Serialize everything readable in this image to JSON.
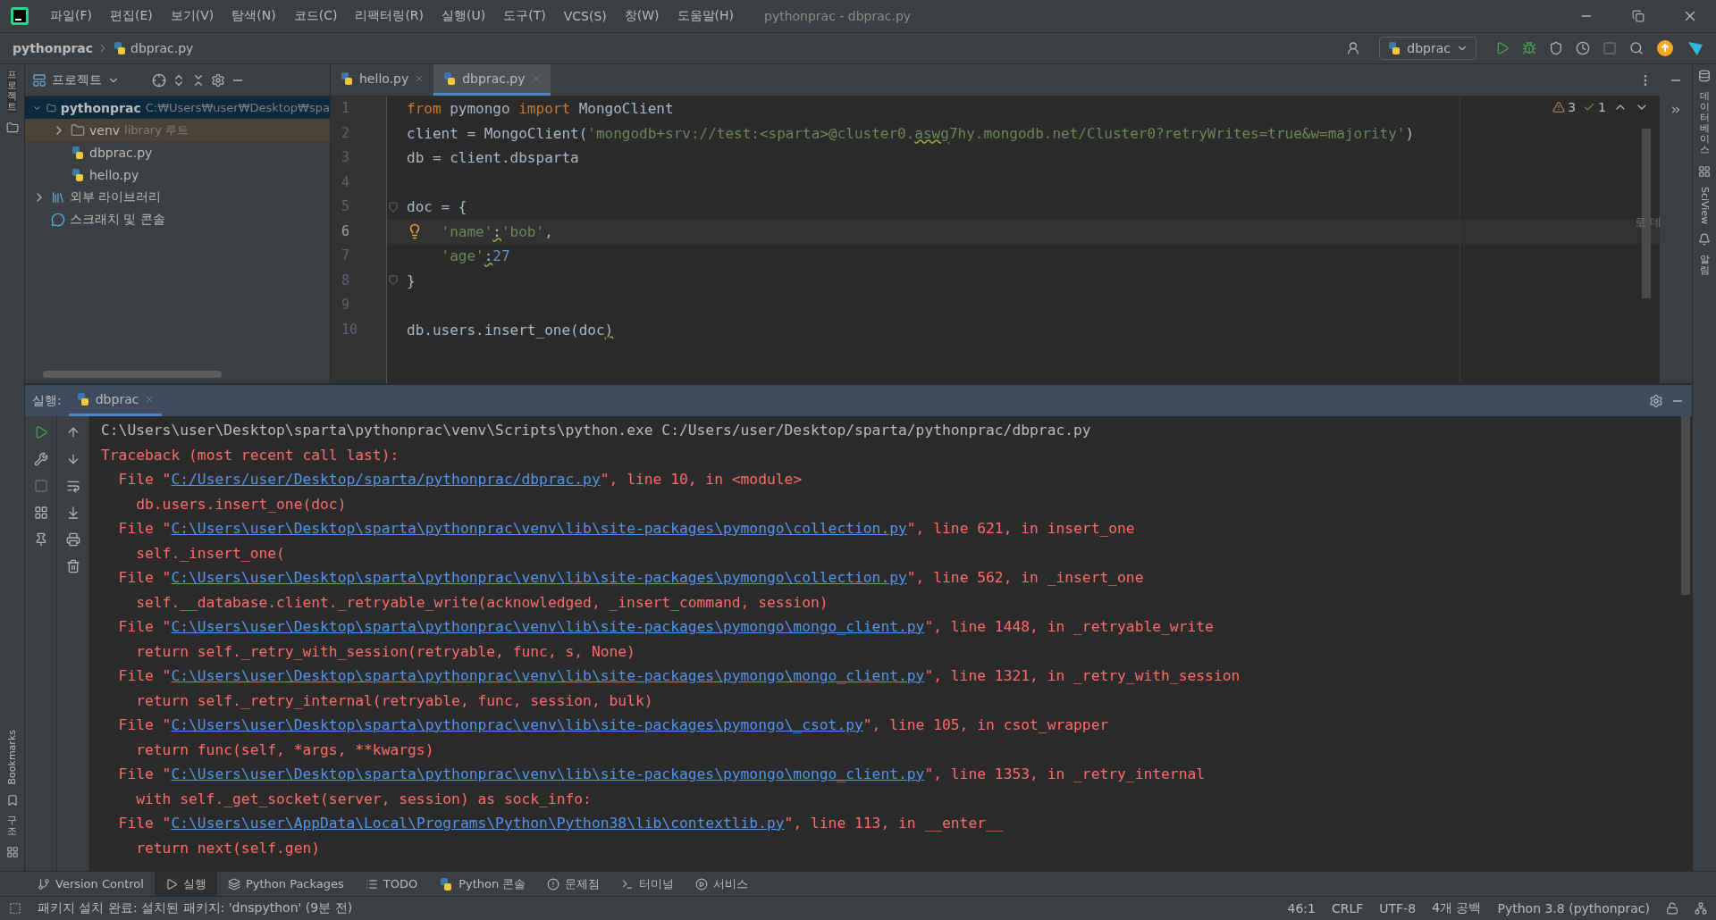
{
  "window": {
    "title": "pythonprac - dbprac.py"
  },
  "menu": [
    "파일(F)",
    "편집(E)",
    "보기(V)",
    "탐색(N)",
    "코드(C)",
    "리팩터링(R)",
    "실행(U)",
    "도구(T)",
    "VCS(S)",
    "창(W)",
    "도움말(H)"
  ],
  "breadcrumb": [
    "pythonprac",
    "dbprac.py"
  ],
  "run_config": "dbprac",
  "left_stripe": [
    "프로젝트",
    "Bookmarks",
    "구조"
  ],
  "project_panel": {
    "title": "프로젝트",
    "tree": [
      {
        "label": "pythonprac",
        "detail": "C:₩Users₩user₩Desktop₩spa",
        "kind": "folder",
        "expanded": true,
        "selected": true,
        "children": [
          {
            "label": "venv",
            "detail": "library 루트",
            "kind": "library-folder",
            "expanded": false,
            "selected": false
          },
          {
            "label": "dbprac.py",
            "kind": "python",
            "selected": false
          },
          {
            "label": "hello.py",
            "kind": "python",
            "selected": false
          }
        ]
      },
      {
        "label": "외부 라이브러리",
        "kind": "libraries",
        "expanded": false,
        "selected": false
      },
      {
        "label": "스크래치 및 콘솔",
        "kind": "scratches",
        "selected": false
      }
    ]
  },
  "editor": {
    "tabs": [
      {
        "label": "hello.py",
        "selected": false
      },
      {
        "label": "dbprac.py",
        "selected": true
      }
    ],
    "inspections": {
      "warnings": "3",
      "ok": "1"
    },
    "side_hint": "로 데",
    "lines": [
      {
        "number": "1",
        "kind": "top",
        "current": false,
        "tokens": [
          {
            "kind": "keyword",
            "text": "from"
          },
          {
            "kind": "text",
            "text": " pymongo "
          },
          {
            "kind": "keyword",
            "text": "import"
          },
          {
            "kind": "text",
            "text": " MongoClient"
          }
        ]
      },
      {
        "number": "2",
        "kind": "top",
        "current": false,
        "tokens": [
          {
            "kind": "text",
            "text": "client = MongoClient("
          },
          {
            "kind": "string",
            "text": "'mongodb+srv://test:<sparta>@cluster0."
          },
          {
            "kind": "string_warn",
            "text": "aswg"
          },
          {
            "kind": "string",
            "text": "7hy.mongodb.net/Cluster0?retryWrites=true&w=majority'"
          },
          {
            "kind": "text",
            "text": ")"
          }
        ]
      },
      {
        "number": "3",
        "kind": "top",
        "current": false,
        "tokens": [
          {
            "kind": "text",
            "text": "db = client.dbsparta"
          }
        ]
      },
      {
        "number": "4",
        "kind": "top",
        "current": false
      },
      {
        "number": "5",
        "kind": "top",
        "current": false,
        "fold": true,
        "tokens": [
          {
            "kind": "text",
            "text": "doc = {"
          }
        ]
      },
      {
        "number": "6",
        "kind": "indented",
        "current": true,
        "bulb": true,
        "tokens": [
          {
            "kind": "string",
            "text": "'name'"
          },
          {
            "kind": "warn",
            "text": ":"
          },
          {
            "kind": "string",
            "text": "'bob'"
          },
          {
            "kind": "text",
            "text": ","
          }
        ]
      },
      {
        "number": "7",
        "kind": "indented",
        "current": false,
        "tokens": [
          {
            "kind": "string",
            "text": "'age'"
          },
          {
            "kind": "warn",
            "text": ":"
          },
          {
            "kind": "number",
            "text": "27"
          }
        ]
      },
      {
        "number": "8",
        "kind": "top",
        "current": false,
        "fold": true,
        "tokens": [
          {
            "kind": "text",
            "text": "}"
          }
        ]
      },
      {
        "number": "9",
        "kind": "top",
        "current": false
      },
      {
        "number": "10",
        "kind": "top",
        "current": false,
        "tokens": [
          {
            "kind": "text",
            "text": "db.users.insert_one(doc"
          },
          {
            "kind": "warn",
            "text": ")"
          }
        ]
      }
    ]
  },
  "right_stripe": [
    "데이터베이스",
    "SciView",
    "알림"
  ],
  "run_panel": {
    "label": "실행:",
    "tabs": [
      {
        "label": "dbprac",
        "selected": true
      }
    ],
    "console": [
      {
        "kind": "command",
        "text": "C:\\Users\\user\\Desktop\\sparta\\pythonprac\\venv\\Scripts\\python.exe C:/Users/user/Desktop/sparta/pythonprac/dbprac.py"
      },
      {
        "kind": "error",
        "text": "Traceback (most recent call last):"
      },
      {
        "kind": "file",
        "prefix": "File \"",
        "link": "C:/Users/user/Desktop/sparta/pythonprac/dbprac.py",
        "suffix": "\", line 10, in <module>"
      },
      {
        "kind": "code",
        "text": "db.users.insert_one(doc)"
      },
      {
        "kind": "file",
        "prefix": "File \"",
        "link": "C:\\Users\\user\\Desktop\\sparta\\pythonprac\\venv\\lib\\site-packages\\pymongo\\collection.py",
        "suffix": "\", line 621, in insert_one"
      },
      {
        "kind": "code",
        "text": "self._insert_one("
      },
      {
        "kind": "file",
        "prefix": "File \"",
        "link": "C:\\Users\\user\\Desktop\\sparta\\pythonprac\\venv\\lib\\site-packages\\pymongo\\collection.py",
        "suffix": "\", line 562, in _insert_one"
      },
      {
        "kind": "code",
        "text": "self.__database.client._retryable_write(acknowledged, _insert_command, session)"
      },
      {
        "kind": "file",
        "prefix": "File \"",
        "link": "C:\\Users\\user\\Desktop\\sparta\\pythonprac\\venv\\lib\\site-packages\\pymongo\\mongo_client.py",
        "suffix": "\", line 1448, in _retryable_write"
      },
      {
        "kind": "code",
        "text": "return self._retry_with_session(retryable, func, s, None)"
      },
      {
        "kind": "file",
        "prefix": "File \"",
        "link": "C:\\Users\\user\\Desktop\\sparta\\pythonprac\\venv\\lib\\site-packages\\pymongo\\mongo_client.py",
        "suffix": "\", line 1321, in _retry_with_session"
      },
      {
        "kind": "code",
        "text": "return self._retry_internal(retryable, func, session, bulk)"
      },
      {
        "kind": "file",
        "prefix": "File \"",
        "link": "C:\\Users\\user\\Desktop\\sparta\\pythonprac\\venv\\lib\\site-packages\\pymongo\\_csot.py",
        "suffix": "\", line 105, in csot_wrapper"
      },
      {
        "kind": "code",
        "text": "return func(self, *args, **kwargs)"
      },
      {
        "kind": "file",
        "prefix": "File \"",
        "link": "C:\\Users\\user\\Desktop\\sparta\\pythonprac\\venv\\lib\\site-packages\\pymongo\\mongo_client.py",
        "suffix": "\", line 1353, in _retry_internal"
      },
      {
        "kind": "code",
        "text": "with self._get_socket(server, session) as sock_info:"
      },
      {
        "kind": "file",
        "prefix": "File \"",
        "link": "C:\\Users\\user\\AppData\\Local\\Programs\\Python\\Python38\\lib\\contextlib.py",
        "suffix": "\", line 113, in __enter__"
      },
      {
        "kind": "code",
        "text": "return next(self.gen)"
      }
    ]
  },
  "tool_bar": [
    {
      "label": "Version Control",
      "kind": "vcs",
      "selected": false
    },
    {
      "label": "실행",
      "kind": "run",
      "selected": true
    },
    {
      "label": "Python Packages",
      "kind": "packages",
      "selected": false
    },
    {
      "label": "TODO",
      "kind": "todo",
      "selected": false
    },
    {
      "label": "Python 콘솔",
      "kind": "python",
      "selected": false
    },
    {
      "label": "문제점",
      "kind": "problems",
      "selected": false
    },
    {
      "label": "터미널",
      "kind": "terminal",
      "selected": false
    },
    {
      "label": "서비스",
      "kind": "services",
      "selected": false
    }
  ],
  "status_bar": {
    "message": "패키지 설치 완료: 설치된 패키지: 'dnspython' (9분 전)",
    "items": [
      "46:1",
      "CRLF",
      "UTF-8",
      "4개 공백",
      "Python 3.8 (pythonprac)"
    ]
  }
}
